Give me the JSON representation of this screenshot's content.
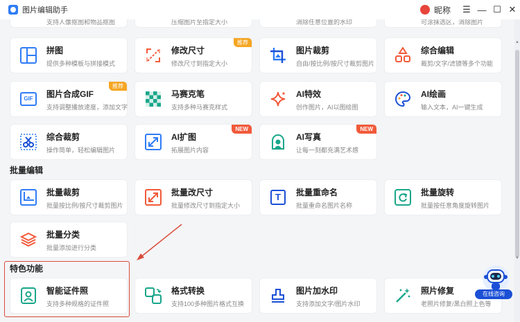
{
  "app": {
    "title": "图片编辑助手",
    "nickname": "昵称"
  },
  "window_controls": {
    "menu": "☰",
    "minimize": "—",
    "maximize": "☐",
    "close": "✕"
  },
  "colors": {
    "accent_blue": "#2f7cf6",
    "badge_recommend": "#f5a623",
    "badge_new": "#f15a3a",
    "highlight_red": "#d94b3a"
  },
  "top_row_partial": [
    {
      "desc": "支持人像抠图和物品抠图"
    },
    {
      "desc": "压缩图片至指定大小"
    },
    {
      "desc": "消除任意位置的水印"
    },
    {
      "desc": "可涂抹选区，消除图片"
    }
  ],
  "single": [
    {
      "title": "拼图",
      "desc": "提供多种模板与拼接模式",
      "icon": "collage-icon"
    },
    {
      "title": "修改尺寸",
      "desc": "修改尺寸到指定大小",
      "icon": "resize-icon",
      "badge": "推荐"
    },
    {
      "title": "图片裁剪",
      "desc": "自由/按比例/按尺寸裁剪图片",
      "icon": "crop-icon"
    },
    {
      "title": "综合编辑",
      "desc": "裁剪/文字/滤镜等多个功能",
      "icon": "shapes-icon"
    },
    {
      "title": "图片合成GIF",
      "desc": "支持调整播放速度，添加文字",
      "icon": "gif-icon",
      "badge": "推荐",
      "icon_text": "GIF"
    },
    {
      "title": "马赛克笔",
      "desc": "支持多种马赛克样式",
      "icon": "mosaic-icon"
    },
    {
      "title": "AI特效",
      "desc": "创作图片，AI以图绘图",
      "icon": "sparkle-icon"
    },
    {
      "title": "AI绘画",
      "desc": "输入文本，AI一键生成",
      "icon": "palette-icon"
    },
    {
      "title": "综合裁剪",
      "desc": "操作简单，轻松编辑图片",
      "icon": "scissors-icon"
    },
    {
      "title": "AI扩图",
      "desc": "拓展图片内容",
      "icon": "expand-icon",
      "badge": "NEW"
    },
    {
      "title": "AI写真",
      "desc": "让每一刻都充满艺术感",
      "icon": "portrait-icon",
      "badge": "NEW"
    }
  ],
  "batch_section": "批量编辑",
  "batch": [
    {
      "title": "批量裁剪",
      "desc": "批量按比例/按尺寸裁剪图片",
      "icon": "batch-crop-icon"
    },
    {
      "title": "批量改尺寸",
      "desc": "批量修改尺寸到指定大小",
      "icon": "batch-resize-icon"
    },
    {
      "title": "批量重命名",
      "desc": "批量重命名图片名称",
      "icon": "rename-icon",
      "icon_text": "T"
    },
    {
      "title": "批量旋转",
      "desc": "批量按任意角度旋转图片",
      "icon": "rotate-icon"
    },
    {
      "title": "批量分类",
      "desc": "批量添加进行分类",
      "icon": "layers-icon"
    }
  ],
  "special_section": "特色功能",
  "special": [
    {
      "title": "智能证件照",
      "desc": "支持多种规格的证件照",
      "icon": "id-photo-icon"
    },
    {
      "title": "格式转换",
      "desc": "支持100多种图片格式互换",
      "icon": "convert-icon"
    },
    {
      "title": "图片加水印",
      "desc": "支持添加文字/图片水印",
      "icon": "watermark-icon"
    },
    {
      "title": "照片修复",
      "desc": "老照片修复/黑白照上色等",
      "icon": "magic-wand-icon"
    }
  ],
  "assistant": {
    "label": "在线咨询"
  }
}
